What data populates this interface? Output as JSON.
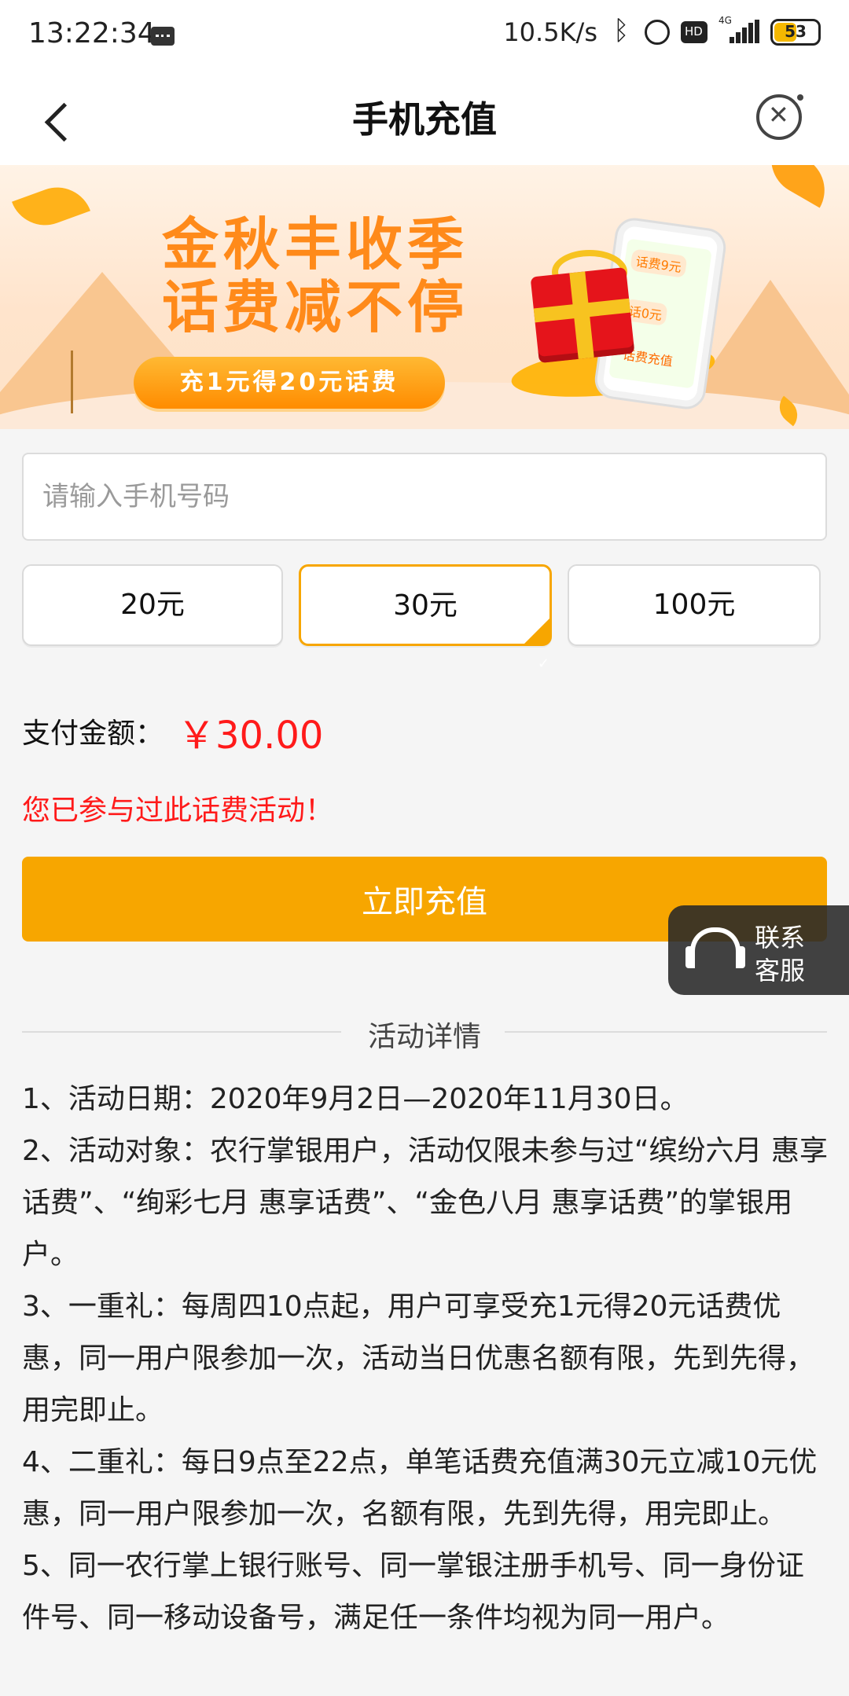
{
  "status_bar": {
    "time": "13:22:34",
    "net_speed": "10.5K/s",
    "signal_label": "4G",
    "battery": "53"
  },
  "nav": {
    "title": "手机充值"
  },
  "banner": {
    "slogan_line1": "金秋丰收季",
    "slogan_line2": "话费减不停",
    "promo_pill": "充1元得20元话费",
    "phone_screen": [
      "话费9元",
      "话0元",
      "话费充值"
    ]
  },
  "form": {
    "phone_placeholder": "请输入手机号码",
    "amount_options": [
      "20元",
      "30元",
      "100元"
    ],
    "selected_option": "30元",
    "pay_label": "支付金额：",
    "pay_value": "￥30.00",
    "notice": "您已参与过此话费活动！",
    "submit_label": "立即充值"
  },
  "customer_service": {
    "line1": "联系",
    "line2": "客服"
  },
  "details": {
    "heading": "活动详情",
    "rules": [
      "1、活动日期：2020年9月2日—2020年11月30日。",
      "2、活动对象：农行掌银用户，活动仅限未参与过“缤纷六月 惠享话费”、“绚彩七月 惠享话费”、“金色八月 惠享话费”的掌银用户。",
      "3、一重礼：每周四10点起，用户可享受充1元得20元话费优惠，同一用户限参加一次，活动当日优惠名额有限，先到先得，用完即止。",
      "4、二重礼：每日9点至22点，单笔话费充值满30元立减10元优惠，同一用户限参加一次，名额有限，先到先得，用完即止。",
      "5、同一农行掌上银行账号、同一掌银注册手机号、同一身份证件号、同一移动设备号，满足任一条件均视为同一用户。"
    ]
  },
  "colors": {
    "accent": "#f7a600",
    "alert": "#ff1a1a",
    "background": "#f5f5f5"
  }
}
